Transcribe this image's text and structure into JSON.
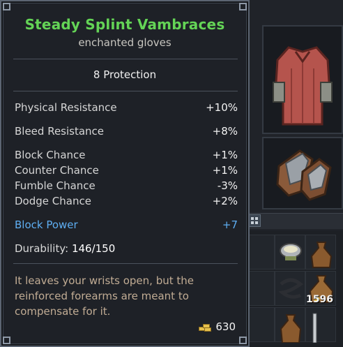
{
  "tooltip": {
    "item_name": "Steady Splint Vambraces",
    "item_type": "enchanted gloves",
    "protection": "8 Protection",
    "stats": [
      {
        "label": "Physical Resistance",
        "value": "+10%"
      },
      {
        "label": "Bleed Resistance",
        "value": "+8%"
      },
      {
        "label": "Block Chance",
        "value": "+1%"
      },
      {
        "label": "Counter Chance",
        "value": "+1%"
      },
      {
        "label": "Fumble Chance",
        "value": "-3%"
      },
      {
        "label": "Dodge Chance",
        "value": "+2%"
      },
      {
        "label": "Block Power",
        "value": "+7"
      }
    ],
    "durability_label": "Durability:",
    "durability_value": "146/150",
    "flavor_lines": [
      "It leaves your wrists open, but the",
      "reinforced forearms are meant to",
      "compensate for it."
    ],
    "price": "630"
  },
  "inventory": {
    "stack_quantity": "1596"
  },
  "colors": {
    "item_name": "#64d456",
    "special_stat": "#5eaef2",
    "flavor": "#c1ac94"
  },
  "icons": [
    "gold-coins-icon",
    "bag-grid-icon",
    "chest-armor-icon",
    "gloves-icon"
  ]
}
